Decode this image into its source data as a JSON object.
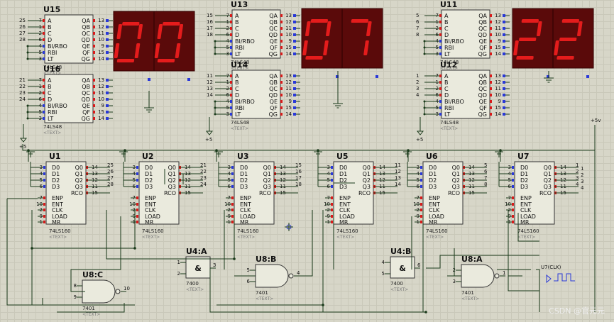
{
  "decoders_upper": [
    {
      "ref": "U15",
      "part": "74LS48",
      "text": "<TEXT>",
      "in_pins": [
        "7",
        "1",
        "2",
        "6",
        "4",
        "5",
        "3"
      ],
      "out_pins": [
        "13",
        "12",
        "11",
        "10",
        "9",
        "15",
        "14"
      ],
      "nets": [
        "25",
        "26",
        "27",
        "28"
      ]
    },
    {
      "ref": "U16",
      "part": "74LS48",
      "text": "<TEXT>",
      "in_pins": [
        "7",
        "1",
        "2",
        "6",
        "4",
        "5",
        "3"
      ],
      "out_pins": [
        "13",
        "12",
        "11",
        "10",
        "9",
        "15",
        "14"
      ],
      "nets": [
        "21",
        "22",
        "23",
        "24"
      ]
    },
    {
      "ref": "U13",
      "part": "74LS48",
      "text": "<TEXT>",
      "in_pins": [
        "7",
        "1",
        "2",
        "6",
        "4",
        "5",
        "3"
      ],
      "out_pins": [
        "13",
        "12",
        "11",
        "10",
        "9",
        "15",
        "14"
      ],
      "nets": [
        "15",
        "16",
        "17",
        "18"
      ]
    },
    {
      "ref": "U14",
      "part": "74LS48",
      "text": "<TEXT>",
      "in_pins": [
        "7",
        "1",
        "2",
        "6",
        "4",
        "5",
        "3"
      ],
      "out_pins": [
        "13",
        "12",
        "11",
        "10",
        "9",
        "15",
        "14"
      ],
      "nets": [
        "11",
        "12",
        "13",
        "14"
      ]
    },
    {
      "ref": "U11",
      "part": "74LS48",
      "text": "<TEXT>",
      "in_pins": [
        "7",
        "1",
        "2",
        "6",
        "4",
        "5",
        "3"
      ],
      "out_pins": [
        "13",
        "12",
        "11",
        "10",
        "9",
        "15",
        "14"
      ],
      "nets": [
        "5",
        "6",
        "7",
        "8"
      ]
    },
    {
      "ref": "U12",
      "part": "74LS48",
      "text": "<TEXT>",
      "in_pins": [
        "7",
        "1",
        "2",
        "6",
        "4",
        "5",
        "3"
      ],
      "out_pins": [
        "13",
        "12",
        "11",
        "10",
        "9",
        "15",
        "14"
      ],
      "nets": [
        "1",
        "2",
        "3",
        "4"
      ]
    }
  ],
  "decoder_pin_names_left": [
    "A",
    "B",
    "C",
    "D",
    "BI/RBO",
    "RBI",
    "LT"
  ],
  "decoder_pin_names_right": [
    "QA",
    "QB",
    "QC",
    "QD",
    "QE",
    "QF",
    "QG"
  ],
  "displays": [
    {
      "digits": "00"
    },
    {
      "digits": "07"
    },
    {
      "digits": "22"
    }
  ],
  "counters": [
    {
      "ref": "U1",
      "part": "74LS160",
      "text": "<TEXT>",
      "out_nets": [
        "25",
        "26",
        "27",
        "28"
      ]
    },
    {
      "ref": "U2",
      "part": "74LS160",
      "text": "<TEXT>",
      "out_nets": [
        "21",
        "22",
        "23",
        "24"
      ]
    },
    {
      "ref": "U3",
      "part": "74LS160",
      "text": "<TEXT>",
      "out_nets": [
        "15",
        "16",
        "17",
        "18"
      ]
    },
    {
      "ref": "U5",
      "part": "74LS160",
      "text": "<TEXT>",
      "out_nets": [
        "11",
        "12",
        "13",
        "14"
      ]
    },
    {
      "ref": "U6",
      "part": "74LS160",
      "text": "<TEXT>",
      "out_nets": [
        "5",
        "6",
        "7",
        "8"
      ]
    },
    {
      "ref": "U7",
      "part": "74LS160",
      "text": "<TEXT>",
      "out_nets": [
        "1",
        "2",
        "3",
        "4"
      ]
    }
  ],
  "counter_pin_names_left": [
    "D0",
    "D1",
    "D2",
    "D3",
    "ENP",
    "ENT",
    "CLK",
    "LOAD",
    "MR"
  ],
  "counter_pin_nums_left": [
    "3",
    "4",
    "5",
    "6",
    "7",
    "10",
    "2",
    "9",
    "1"
  ],
  "counter_pin_names_right": [
    "Q0",
    "Q1",
    "Q2",
    "Q3",
    "RCO"
  ],
  "counter_pin_nums_right": [
    "14",
    "13",
    "12",
    "11",
    "15"
  ],
  "gates": [
    {
      "ref": "U4:A",
      "part": "7400",
      "text": "<TEXT>",
      "type": "nand-amp",
      "pins": [
        "1",
        "2",
        "3"
      ]
    },
    {
      "ref": "U8:B",
      "part": "7401",
      "text": "<TEXT>",
      "type": "nand",
      "pins": [
        "5",
        "6",
        "4"
      ]
    },
    {
      "ref": "U4:B",
      "part": "7400",
      "text": "<TEXT>",
      "type": "nand-amp",
      "pins": [
        "4",
        "5",
        "6"
      ]
    },
    {
      "ref": "U8:A",
      "part": "7401",
      "text": "<TEXT>",
      "type": "nand",
      "pins": [
        "2",
        "3",
        "1"
      ]
    },
    {
      "ref": "U8:C",
      "part": "7401",
      "text": "<TEXT>",
      "type": "nand",
      "pins": [
        "8",
        "9",
        "10"
      ]
    }
  ],
  "labels": {
    "plus5": "+5",
    "plus5v": "+5v",
    "clock": "U7(CLK)",
    "watermark": "CSDN @官元元"
  }
}
